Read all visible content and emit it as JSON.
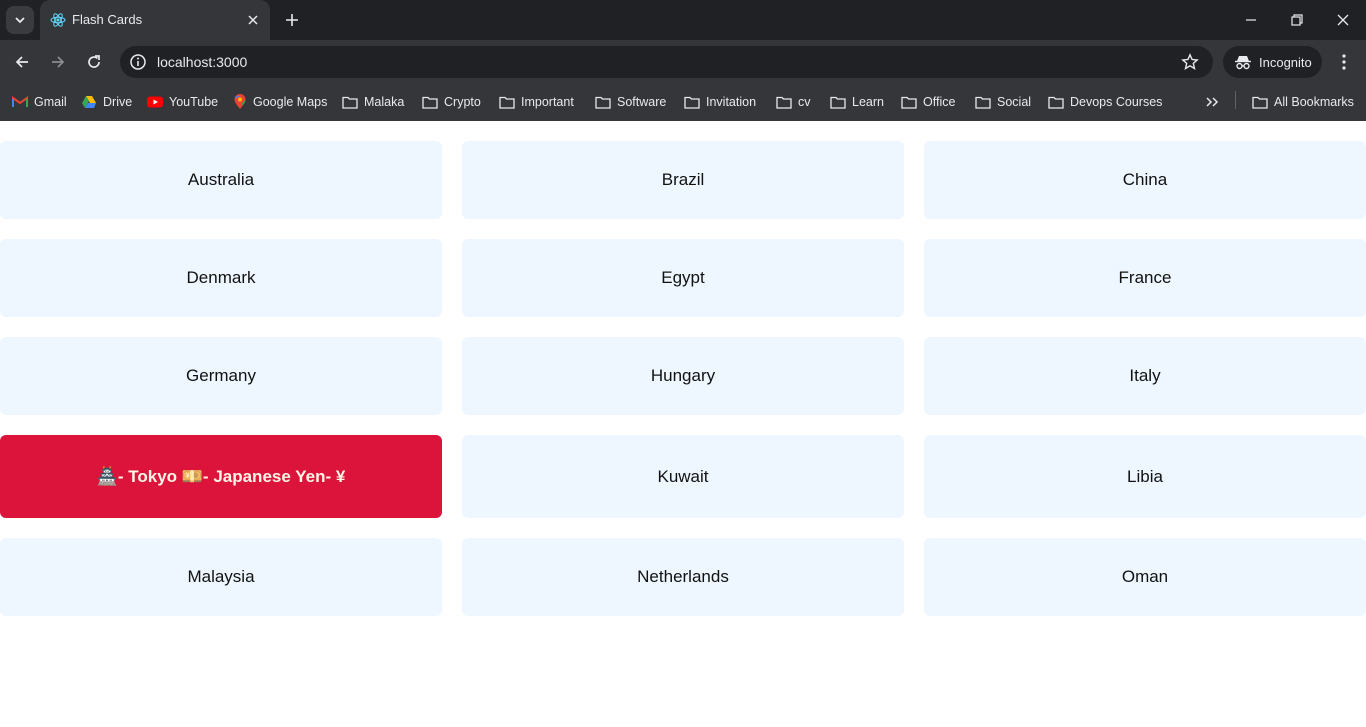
{
  "browser": {
    "tab_title": "Flash Cards",
    "url": "localhost:3000",
    "incognito_label": "Incognito",
    "bookmarks": [
      "Gmail",
      "Drive",
      "YouTube",
      "Google Maps",
      "Malaka",
      "Crypto",
      "Important",
      "Software",
      "Invitation",
      "cv",
      "Learn",
      "Office",
      "Social",
      "Devops Courses"
    ],
    "all_bookmarks": "All Bookmarks"
  },
  "cards": [
    "Australia",
    "Brazil",
    "China",
    "Denmark",
    "Egypt",
    "France",
    "Germany",
    "Hungary",
    "Italy",
    "🏯- Tokyo 💴- Japanese Yen- ¥",
    "Kuwait",
    "Libia",
    "Malaysia",
    "Netherlands",
    "Oman"
  ],
  "active_card_index": 9,
  "colors": {
    "card_bg": "#eef7ff",
    "active_bg": "#dc143c",
    "active_text": "#fdf5e6",
    "chrome_dark": "#202124",
    "chrome_toolbar": "#35363a"
  }
}
